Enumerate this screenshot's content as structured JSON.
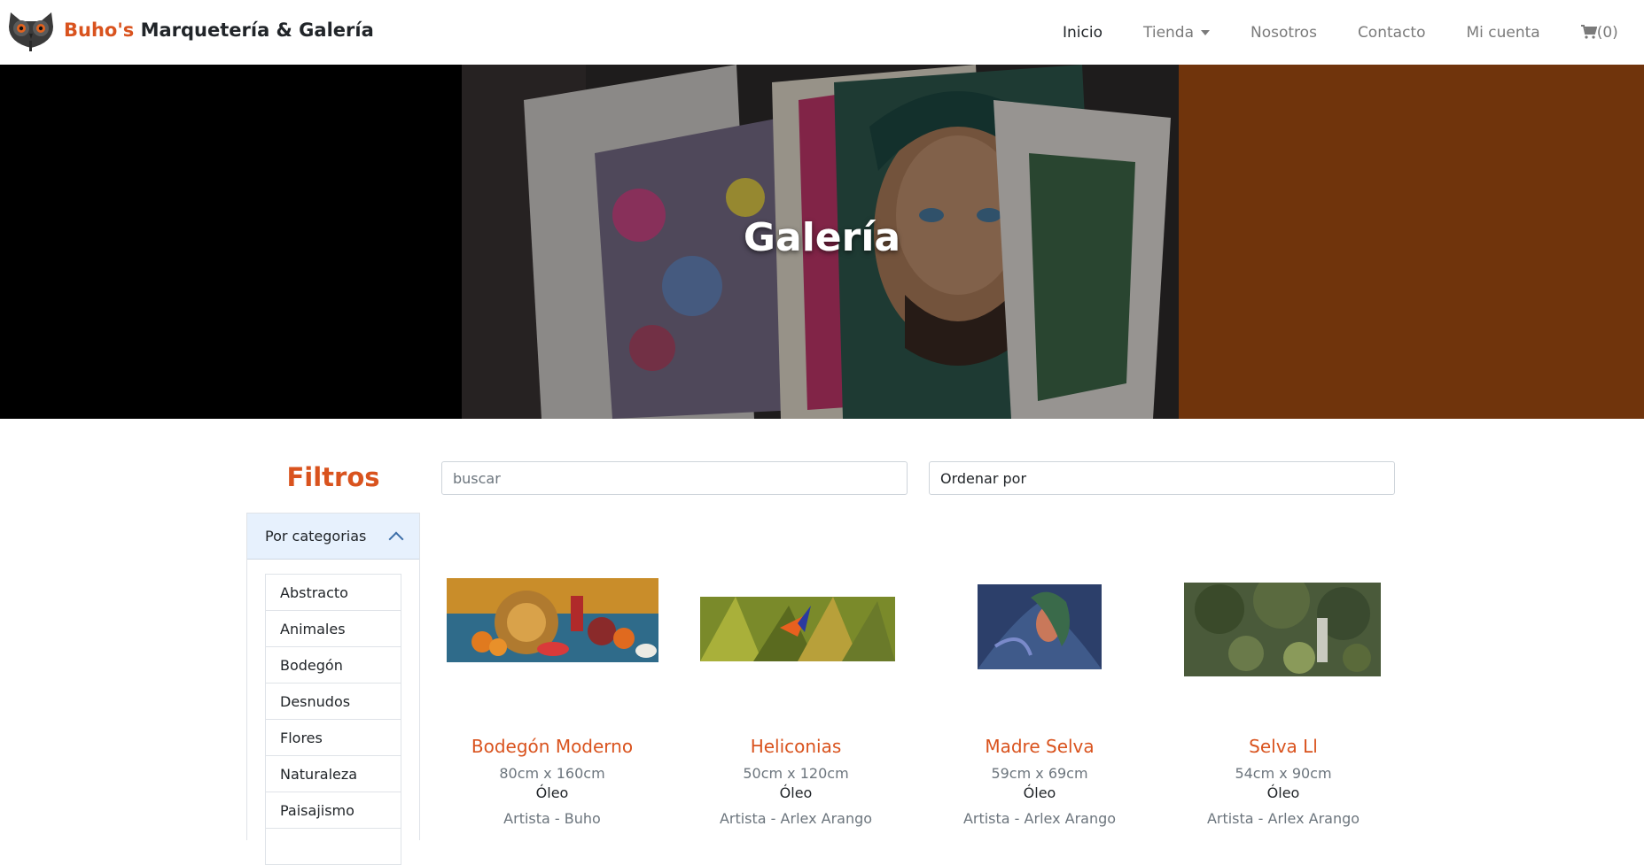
{
  "navbar": {
    "brand_accent": "Buho's",
    "brand_rest": "Marquetería & Galería",
    "links": [
      {
        "label": "Inicio",
        "active": true
      },
      {
        "label": "Tienda",
        "dropdown": true
      },
      {
        "label": "Nosotros"
      },
      {
        "label": "Contacto"
      },
      {
        "label": "Mi cuenta"
      },
      {
        "label": "(0)",
        "icon": "cart-icon"
      }
    ]
  },
  "hero": {
    "title": "Galería"
  },
  "sidebar": {
    "title": "Filtros",
    "category_header": "Por categorias",
    "categories": [
      "Abstracto",
      "Animales",
      "Bodegón",
      "Desnudos",
      "Flores",
      "Naturaleza",
      "Paisajismo"
    ]
  },
  "search": {
    "placeholder": "buscar"
  },
  "order": {
    "label": "Ordenar por"
  },
  "products": [
    {
      "title": "Bodegón Moderno",
      "size": "80cm x 160cm",
      "technique": "Óleo",
      "artist": "Artista - Buho"
    },
    {
      "title": "Heliconias",
      "size": "50cm x 120cm",
      "technique": "Óleo",
      "artist": "Artista - Arlex Arango"
    },
    {
      "title": "Madre Selva",
      "size": "59cm x 69cm",
      "technique": "Óleo",
      "artist": "Artista - Arlex Arango"
    },
    {
      "title": "Selva Ll",
      "size": "54cm x 90cm",
      "technique": "Óleo",
      "artist": "Artista - Arlex Arango"
    }
  ],
  "colors": {
    "accent": "#d9531e",
    "hero_right": "#70340c"
  }
}
